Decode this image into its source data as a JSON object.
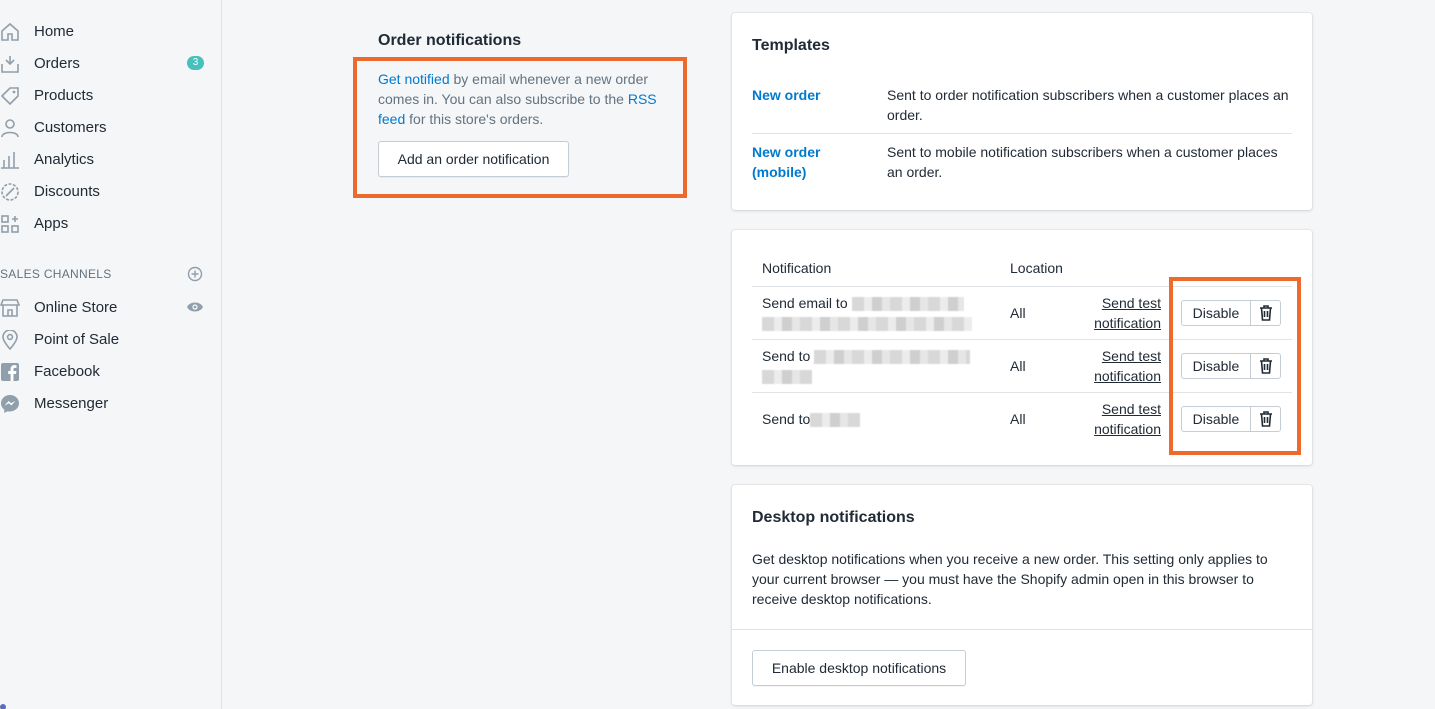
{
  "sidebar": {
    "items": [
      {
        "label": "Home",
        "icon": "home-icon"
      },
      {
        "label": "Orders",
        "icon": "orders-icon",
        "badge": "3"
      },
      {
        "label": "Products",
        "icon": "tag-icon"
      },
      {
        "label": "Customers",
        "icon": "person-icon"
      },
      {
        "label": "Analytics",
        "icon": "bar-chart-icon"
      },
      {
        "label": "Discounts",
        "icon": "discount-icon"
      },
      {
        "label": "Apps",
        "icon": "apps-icon"
      }
    ],
    "sales_channels_label": "SALES CHANNELS",
    "channels": [
      {
        "label": "Online Store",
        "icon": "store-icon"
      },
      {
        "label": "Point of Sale",
        "icon": "location-pin-icon"
      },
      {
        "label": "Facebook",
        "icon": "facebook-icon"
      },
      {
        "label": "Messenger",
        "icon": "messenger-icon"
      }
    ]
  },
  "order_notifications": {
    "title": "Order notifications",
    "desc_link1": "Get notified",
    "desc_text1": " by email whenever a new order comes in. You can also subscribe to the ",
    "desc_link2": "RSS feed",
    "desc_text2": " for this store's orders.",
    "add_button": "Add an order notification"
  },
  "templates": {
    "title": "Templates",
    "rows": [
      {
        "name": "New order",
        "desc": "Sent to order notification subscribers when a customer places an order."
      },
      {
        "name": "New order (mobile)",
        "desc": "Sent to mobile notification subscribers when a customer places an order."
      }
    ]
  },
  "notifications_table": {
    "headers": {
      "notification": "Notification",
      "location": "Location"
    },
    "rows": [
      {
        "prefix": "Send email to",
        "location": "All",
        "send_test": "Send test notification",
        "disable": "Disable"
      },
      {
        "prefix": "Send to",
        "location": "All",
        "send_test": "Send test notification",
        "disable": "Disable"
      },
      {
        "prefix": "Send to",
        "location": "All",
        "send_test": "Send test notification",
        "disable": "Disable"
      }
    ]
  },
  "desktop": {
    "title": "Desktop notifications",
    "desc": "Get desktop notifications when you receive a new order. This setting only applies to your current browser — you must have the Shopify admin open in this browser to receive desktop notifications.",
    "button": "Enable desktop notifications"
  },
  "colors": {
    "link": "#007ace",
    "highlight": "#ee6a2c",
    "badge": "#47c1bf"
  }
}
